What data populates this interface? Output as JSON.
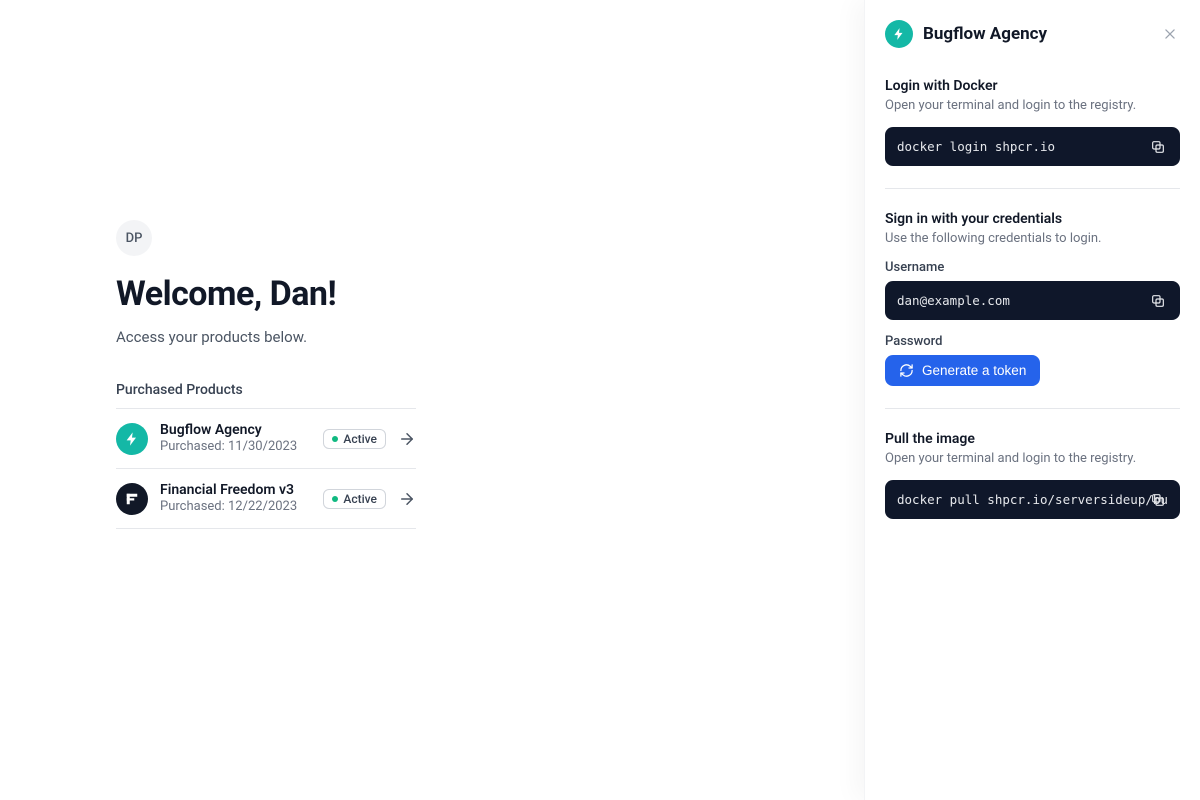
{
  "user": {
    "initials": "DP",
    "welcome": "Welcome, Dan!",
    "subtitle": "Access your products below."
  },
  "products": {
    "heading": "Purchased Products",
    "items": [
      {
        "name": "Bugflow Agency",
        "purchased_label": "Purchased: 11/30/2023",
        "status": "Active",
        "icon": "bolt",
        "icon_bg": "teal"
      },
      {
        "name": "Financial Freedom v3",
        "purchased_label": "Purchased: 12/22/2023",
        "status": "Active",
        "icon": "ff",
        "icon_bg": "dark"
      }
    ]
  },
  "panel": {
    "title": "Bugflow Agency",
    "sections": {
      "login": {
        "title": "Login with Docker",
        "desc": "Open your terminal and login to the registry.",
        "command": "docker login shpcr.io"
      },
      "creds": {
        "title": "Sign in with your credentials",
        "desc": "Use the following credentials to login.",
        "username_label": "Username",
        "username_value": "dan@example.com",
        "password_label": "Password",
        "token_button": "Generate a token"
      },
      "pull": {
        "title": "Pull the image",
        "desc": "Open your terminal and login to the registry.",
        "command": "docker pull shpcr.io/serversideup/bu"
      }
    }
  }
}
